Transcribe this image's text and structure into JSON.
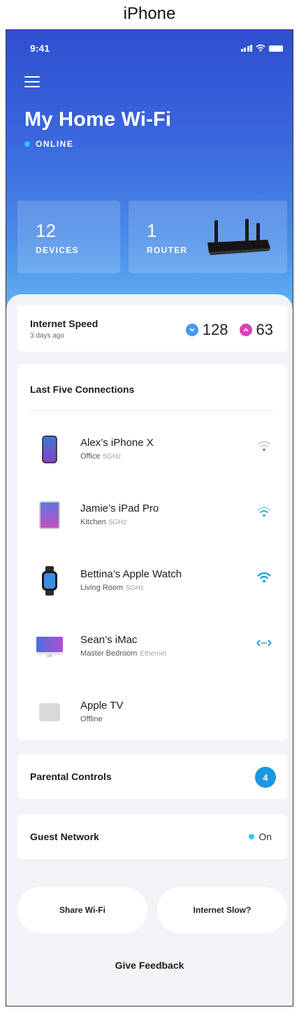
{
  "caption": "iPhone",
  "status_bar": {
    "time": "9:41"
  },
  "header": {
    "title": "My Home Wi-Fi",
    "status": "ONLINE",
    "status_color": "#28c8ff"
  },
  "stats": {
    "devices": {
      "count": "12",
      "label": "DEVICES"
    },
    "router": {
      "count": "1",
      "label": "ROUTER"
    }
  },
  "internet_speed": {
    "title": "Internet Speed",
    "subtitle": "3 days ago",
    "download": "128",
    "upload": "63",
    "download_color": "#4a98f0",
    "upload_color": "#e040b8"
  },
  "connections": {
    "title": "Last Five Connections",
    "items": [
      {
        "name": "Alex’s iPhone X",
        "location": "Office",
        "band": "5GHz",
        "device_icon": "iphone-icon",
        "connection_icon": "wifi-icon"
      },
      {
        "name": "Jamie’s iPad Pro",
        "location": "Kitchen",
        "band": "5GHz",
        "device_icon": "ipad-icon",
        "connection_icon": "wifi-icon"
      },
      {
        "name": "Bettina’s Apple Watch",
        "location": "Living Room",
        "band": "5GHz",
        "device_icon": "watch-icon",
        "connection_icon": "wifi-icon"
      },
      {
        "name": "Sean’s iMac",
        "location": "Master Bedroom",
        "band": "Ethernet",
        "device_icon": "imac-icon",
        "connection_icon": "ethernet-icon"
      },
      {
        "name": "Apple TV",
        "location": "Offline",
        "band": "",
        "device_icon": "apple-tv-icon",
        "connection_icon": ""
      }
    ]
  },
  "parental_controls": {
    "label": "Parental Controls",
    "count": "4"
  },
  "guest_network": {
    "label": "Guest Network",
    "state": "On"
  },
  "actions": {
    "share": "Share Wi-Fi",
    "slow": "Internet Slow?",
    "feedback": "Give Feedback"
  },
  "colors": {
    "accent": "#1a97e0",
    "hero_top": "#2f4fd0",
    "hero_bottom": "#6cc2f2"
  }
}
